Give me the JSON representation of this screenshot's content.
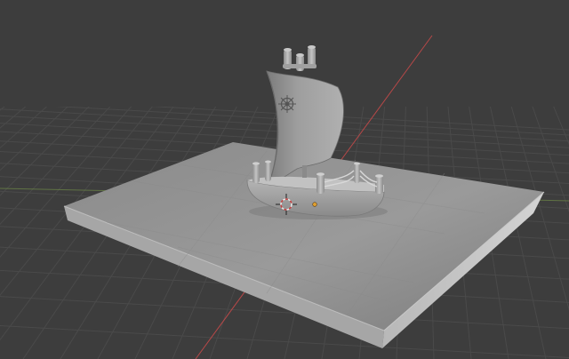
{
  "viewport": {
    "background_color": "#3d3d3d",
    "grid_minor_color": "#474747",
    "x_axis_color": "#c04a4a",
    "y_axis_color": "#7a9a4a"
  },
  "scene": {
    "ground_plane_color": "#8e8e8e",
    "ground_plane_edge_color": "#b0b0b0",
    "boat_color": "#a4a4a4",
    "sail_color": "#9a9a9a",
    "origin_marker_color": "#e08030"
  }
}
